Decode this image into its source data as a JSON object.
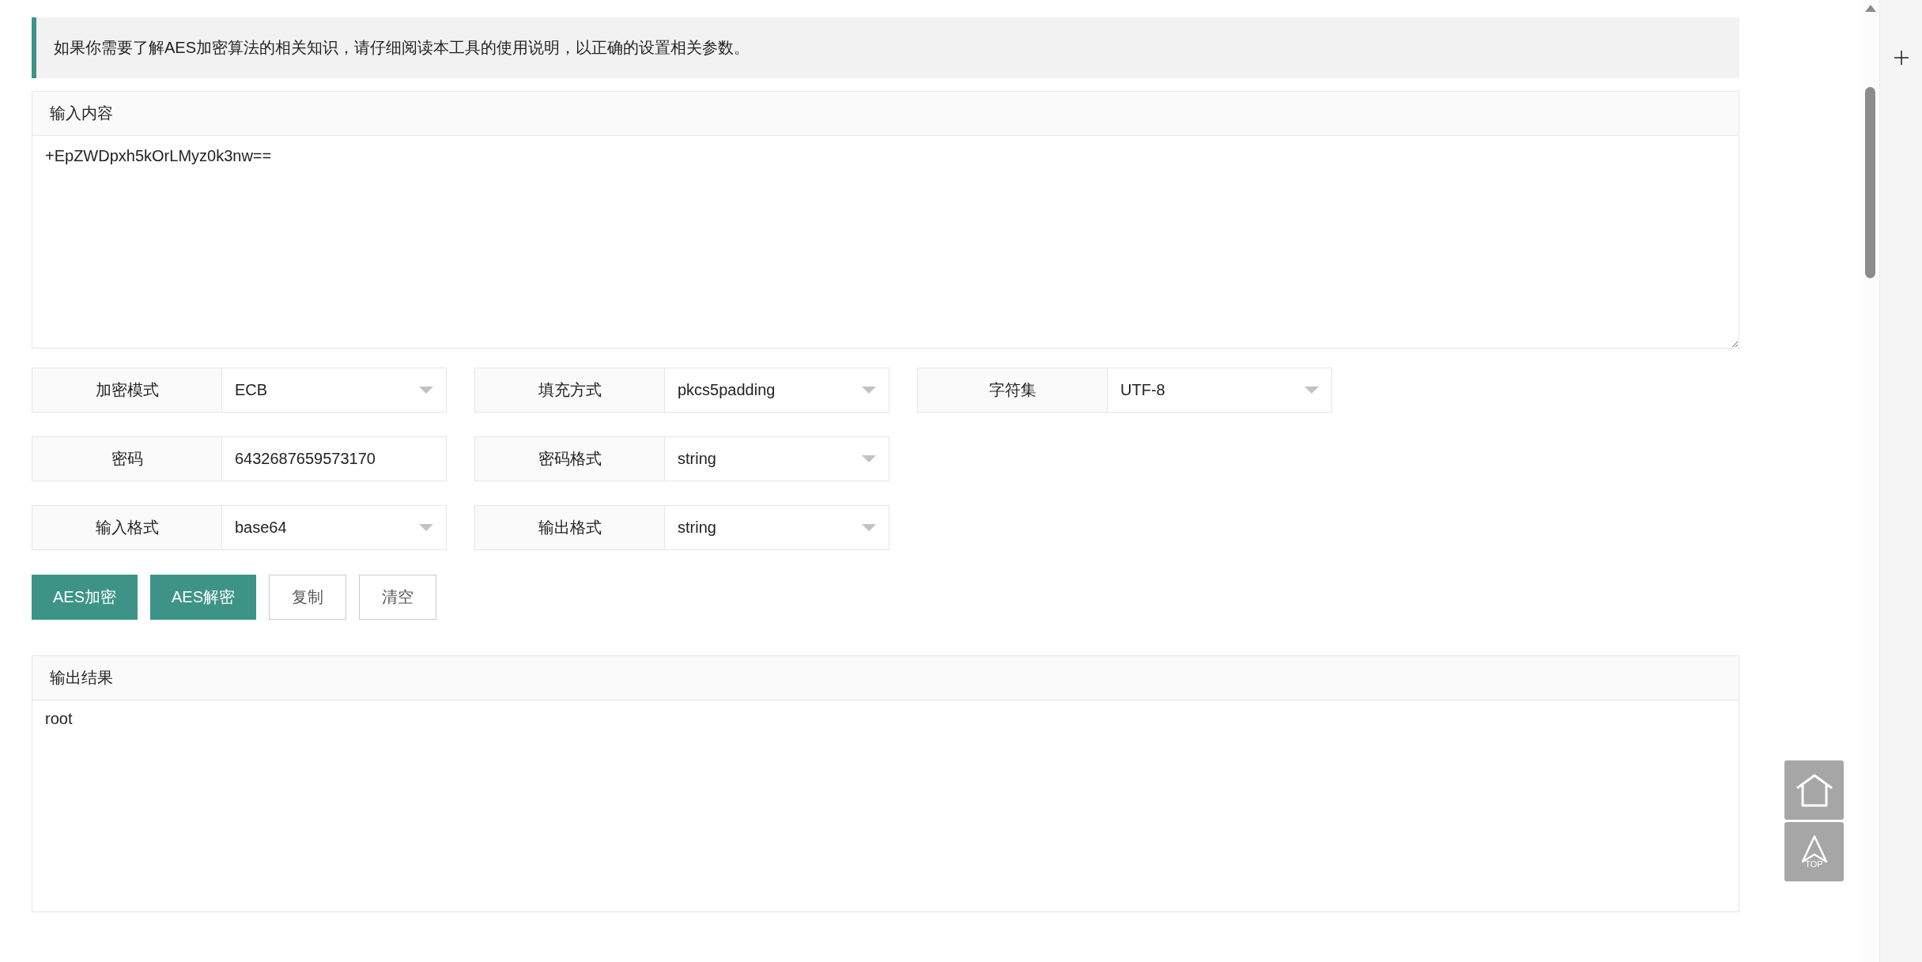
{
  "notice": "如果你需要了解AES加密算法的相关知识，请仔细阅读本工具的使用说明，以正确的设置相关参数。",
  "input_panel": {
    "title": "输入内容",
    "value": "+EpZWDpxh5kOrLMyz0k3nw=="
  },
  "field_rows": [
    [
      {
        "label": "加密模式",
        "value": "ECB",
        "kind": "select"
      },
      {
        "label": "填充方式",
        "value": "pkcs5padding",
        "kind": "select"
      },
      {
        "label": "字符集",
        "value": "UTF-8",
        "kind": "select"
      }
    ],
    [
      {
        "label": "密码",
        "value": "6432687659573170",
        "kind": "text"
      },
      {
        "label": "密码格式",
        "value": "string",
        "kind": "select"
      }
    ],
    [
      {
        "label": "输入格式",
        "value": "base64",
        "kind": "select"
      },
      {
        "label": "输出格式",
        "value": "string",
        "kind": "select"
      }
    ]
  ],
  "buttons": [
    {
      "label": "AES加密",
      "kind": "primary"
    },
    {
      "label": "AES解密",
      "kind": "primary"
    },
    {
      "label": "复制",
      "kind": "plain"
    },
    {
      "label": "清空",
      "kind": "plain"
    }
  ],
  "output_panel": {
    "title": "输出结果",
    "value": "root"
  },
  "float_buttons": [
    {
      "kind": "home"
    },
    {
      "kind": "top",
      "label": "TOP"
    }
  ]
}
